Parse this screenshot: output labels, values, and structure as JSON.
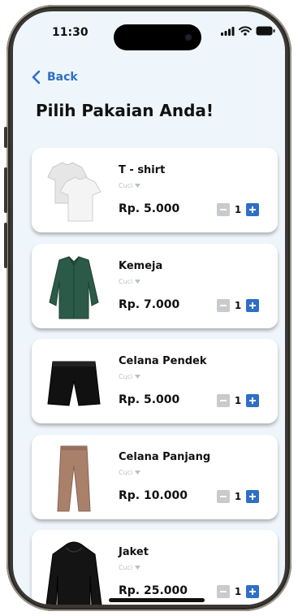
{
  "status_bar": {
    "time": "11:30",
    "icons": [
      "signal-icon",
      "wifi-icon",
      "battery-icon"
    ]
  },
  "header": {
    "back_label": "Back",
    "title": "Pilih Pakaian Anda!"
  },
  "colors": {
    "accent": "#2f6fc4",
    "background": "#eef6fc",
    "card": "#ffffff",
    "minus_button": "#c8cace"
  },
  "items": [
    {
      "name": "T - shirt",
      "service": "Cuci",
      "price": "Rp. 5.000",
      "qty": "1",
      "icon": "tshirt-icon"
    },
    {
      "name": "Kemeja",
      "service": "Cuci",
      "price": "Rp. 7.000",
      "qty": "1",
      "icon": "shirt-icon"
    },
    {
      "name": "Celana Pendek",
      "service": "Cuci",
      "price": "Rp. 5.000",
      "qty": "1",
      "icon": "shorts-icon"
    },
    {
      "name": "Celana Panjang",
      "service": "Cuci",
      "price": "Rp. 10.000",
      "qty": "1",
      "icon": "pants-icon"
    },
    {
      "name": "Jaket",
      "service": "Cuci",
      "price": "Rp. 25.000",
      "qty": "1",
      "icon": "jacket-icon"
    }
  ]
}
